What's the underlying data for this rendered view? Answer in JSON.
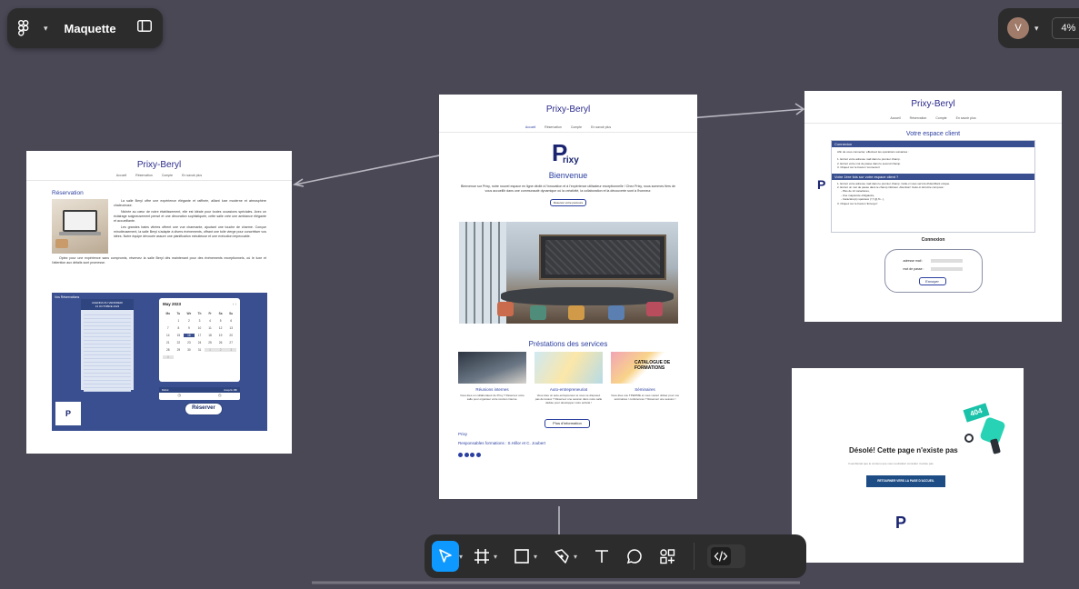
{
  "app": {
    "file_name": "Maquette",
    "user_initial": "V",
    "zoom": "4%"
  },
  "colors": {
    "canvas": "#4a4855",
    "toolbar": "#2c2c2c",
    "accent": "#0d99ff",
    "brand_blue": "#2b2a8c",
    "panel_blue": "#3a4f8f"
  },
  "frames": {
    "reservation": {
      "title": "Prixy-Beryl",
      "nav": [
        "Accueil",
        "Réservation",
        "Compte",
        "En savoir plus"
      ],
      "heading": "Réservation",
      "para1": "La salle Beryl offre une expérience élégante et raffinée, alliant luxe moderne et atmosphère chaleureuse.",
      "para2": "Nichée au cœur de notre établissement, elle est idéale pour toutes occasions spéciales. Avec un éclairage soigneusement pensé et une décoration sophistiquée, cette salle crée une ambiance élégante et accueillante.",
      "para3": "Les grandes baies vitrées offrent une vue charmante, ajoutant une touche de charme. Conçue minutieusement, la salle Beryl s'adapte à divers événements, offrant une toile vierge pour concrétiser vos idées. Notre équipe dévouée assure une planification minutieuse et une exécution impeccable.",
      "para4": "Optez pour une expérience sans compromis, réservez la salle Beryl dès maintenant pour des événements exceptionnels, où le luxe et l'attention aux détails sont promesse.",
      "panel_label": "Vos Réservations",
      "agenda_title": "AGENDA DU VENDREDI",
      "agenda_date": "13 OCTOBRE 2023",
      "calendar_month": "May 2023",
      "weekdays": [
        "Mo",
        "Tu",
        "We",
        "Th",
        "Fr",
        "Sa",
        "Su"
      ],
      "days": [
        "",
        "1",
        "2",
        "3",
        "4",
        "5",
        "6",
        "7",
        "8",
        "9",
        "10",
        "11",
        "12",
        "13",
        "14",
        "15",
        "16",
        "17",
        "18",
        "19",
        "20",
        "21",
        "22",
        "23",
        "24",
        "25",
        "26",
        "27",
        "28",
        "29",
        "30",
        "31",
        "1",
        "2",
        "3",
        "4"
      ],
      "time_labels": [
        "Début",
        "Jusqu'à 18h"
      ],
      "reserve_button": "Réserver"
    },
    "home": {
      "title": "Prixy-Beryl",
      "nav": [
        "Accueil",
        "Réservation",
        "Compte",
        "En savoir plus"
      ],
      "logo_text": "rixy",
      "welcome": "Bienvenue",
      "intro": "Bienvenue sur Prixy, notre nouvel espace en ligne dédié à l'innovation et à l'expérience utilisateur exceptionnelle ! Chez Prixy, nous sommes fiers de vous accueillir dans une communauté dynamique où la créativité, la collaboration et la découverte sont à l'honneur.",
      "cta": "Réserver votre parcours",
      "services_heading": "Préstations des services",
      "services": [
        {
          "title": "Réunions internes",
          "desc": "Vous êtes un collaborateur de Prixy ? Réservez votre salle pour organiser votre réunion interne."
        },
        {
          "title": "Auto-entrepreneuriat",
          "desc": "Vous êtes un auto-entrepreneur et vous ne disposez pas de locaux ? Réservez une session dans notre salle dédiée pour développer votre activité !"
        },
        {
          "title": "Séminaires",
          "desc": "Vous êtes une TPE/PME et vous voulez utiliser pour vos séminaires / conférences ? Réservez une session !"
        }
      ],
      "catalogue_label": "CATALOGUE DE FORMATIONS",
      "more_button": "Plus d'information",
      "footer_brand": "Prixy",
      "footer_resp": "Responsables formations : S.Hillor et C. Joubert"
    },
    "account": {
      "title": "Prixy-Beryl",
      "nav": [
        "Accueil",
        "Réservation",
        "Compte",
        "En savoir plus"
      ],
      "heading": "Votre espace client",
      "section1": "Connexion",
      "section1_text": "Afin de vous connecter, effectuez les opérations suivantes :",
      "steps1": [
        "1. Entrez votre adresse mail dans le premier champ.",
        "2. Entrez votre mot de passe dans le second champ.",
        "3. Cliquez sur le bouton 'connexion'"
      ],
      "section2": "Votre 1ère fois sur votre espace client ?",
      "steps2": [
        "1. Entrez votre adresse mail dans le premier champ. Celle-ci vous servira d'identifiant unique.",
        "2. Entrez un mot de passe dans le champ inférieur. Attention! Celui-ci doit être composé :",
        "- Plus de 12 caractères,",
        "- Une majuscule obligatoire,",
        "- Caractère(s) spéciaux (!,?,@,%...),",
        "3. Cliquez sur le bouton 'Envoyer'"
      ],
      "login_label": "Connexion",
      "email_label": "adresse mail :",
      "password_label": "mot de passe :",
      "submit": "Envoyer"
    },
    "notfound": {
      "message": "Désolé! Cette page n'existe pas",
      "sub": "Il semblerait que le contenu que vous souhaitiez consulter n'existe pas",
      "button": "RETOURNER VERS LA PAGE D'ACCUEIL",
      "badge": "404"
    }
  }
}
